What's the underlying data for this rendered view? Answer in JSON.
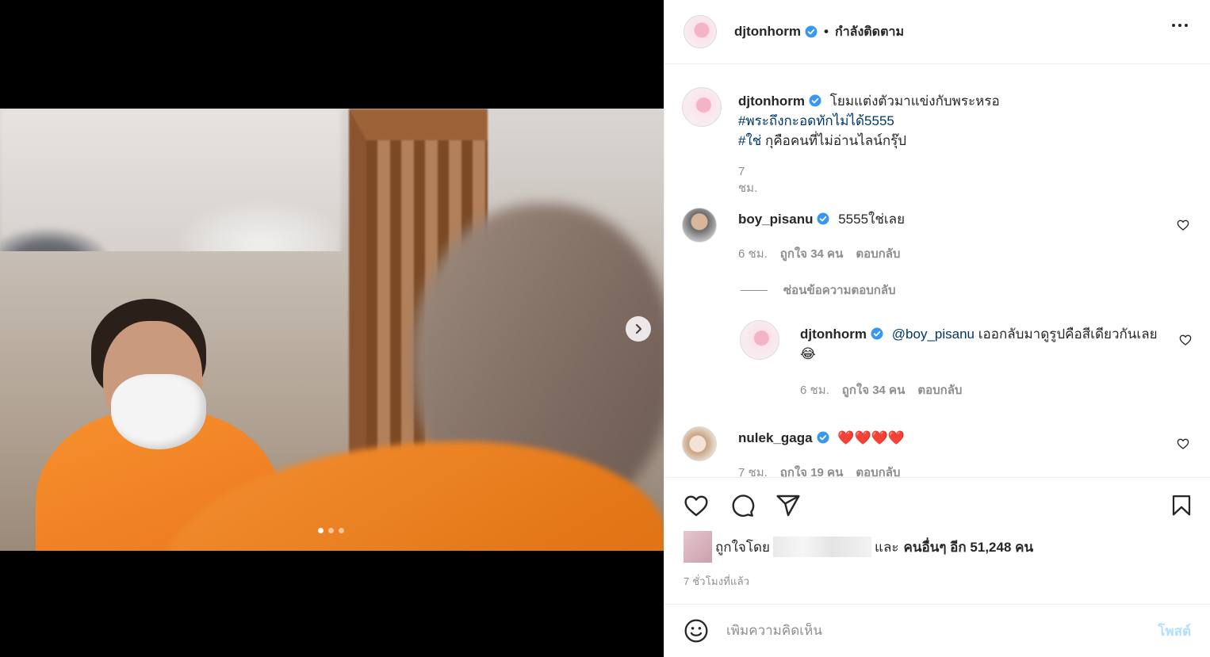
{
  "post": {
    "author": "djtonhorm",
    "follow_status": "กำลังติดตาม",
    "dot": "•",
    "caption_text": "โยมแต่งตัวมาแข่งกับพระหรอ",
    "caption_tag1": "#พระถึงกะอดทักไม่ได้5555",
    "caption_tag2": "#ใช่",
    "caption_line3": " กุคือคนที่ไม่อ่านไลน์กรุ๊ป",
    "caption_time": "7 ชม."
  },
  "carousel": {
    "slides": 3,
    "active_index": 0
  },
  "comments": [
    {
      "user": "boy_pisanu",
      "text": "5555ใช่เลย",
      "time": "6 ชม.",
      "likes": "ถูกใจ 34 คน",
      "reply": "ตอบกลับ"
    },
    {
      "user": "nulek_gaga",
      "text": "❤️❤️❤️❤️",
      "time": "7 ชม.",
      "likes": "ถูกใจ 19 คน",
      "reply": "ตอบกลับ"
    }
  ],
  "hide_replies": "ซ่อนข้อความตอบกลับ",
  "reply": {
    "user": "djtonhorm",
    "mention": "@boy_pisanu",
    "text": " เออกลับมาดูรูปคือสีเดียวกันเลย😂",
    "time": "6 ชม.",
    "likes": "ถูกใจ 34 คน",
    "reply": "ตอบกลับ"
  },
  "likes": {
    "prefix": "ถูกใจโดย",
    "and": "และ",
    "count": "คนอื่นๆ อีก 51,248 คน"
  },
  "time_ago": "7 ชั่วโมงที่แล้ว",
  "add_comment": {
    "placeholder": "เพิ่มความคิดเห็น",
    "post_label": "โพสต์"
  },
  "colors": {
    "verified": "#3897f0",
    "link": "#00376b",
    "post_disabled": "#b2dffc"
  },
  "icons": [
    "heart-icon",
    "comment-icon",
    "share-icon",
    "bookmark-icon",
    "emoji-icon",
    "more-icon",
    "chevron-right-icon",
    "verified-icon"
  ]
}
